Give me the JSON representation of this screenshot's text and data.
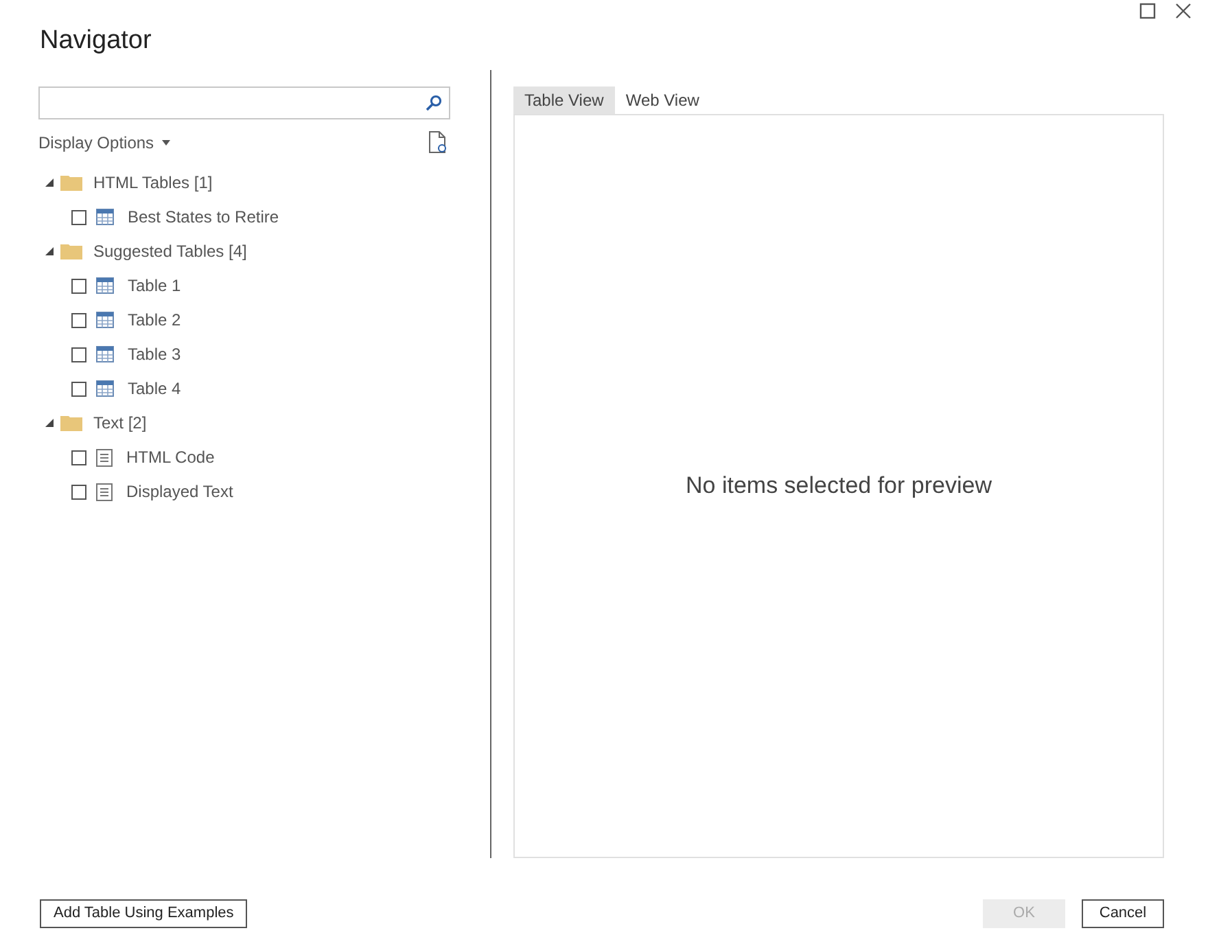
{
  "window": {
    "title": "Navigator"
  },
  "display_options": {
    "label": "Display Options"
  },
  "tree": [
    {
      "label": "HTML Tables [1]",
      "expanded": true,
      "children": [
        {
          "label": "Best States to Retire",
          "kind": "table",
          "checked": false
        }
      ]
    },
    {
      "label": "Suggested Tables [4]",
      "expanded": true,
      "children": [
        {
          "label": "Table 1",
          "kind": "table",
          "checked": false
        },
        {
          "label": "Table 2",
          "kind": "table",
          "checked": false
        },
        {
          "label": "Table 3",
          "kind": "table",
          "checked": false
        },
        {
          "label": "Table 4",
          "kind": "table",
          "checked": false
        }
      ]
    },
    {
      "label": "Text [2]",
      "expanded": true,
      "children": [
        {
          "label": "HTML Code",
          "kind": "text",
          "checked": false
        },
        {
          "label": "Displayed Text",
          "kind": "text",
          "checked": false
        }
      ]
    }
  ],
  "tabs": [
    {
      "label": "Table View",
      "selected": true
    },
    {
      "label": "Web View",
      "selected": false
    }
  ],
  "preview": {
    "message": "No items selected for preview"
  },
  "buttons": [
    {
      "label": "Add Table Using Examples",
      "disabled": false
    },
    {
      "label": "OK",
      "disabled": true
    },
    {
      "label": "Cancel",
      "disabled": false
    }
  ]
}
